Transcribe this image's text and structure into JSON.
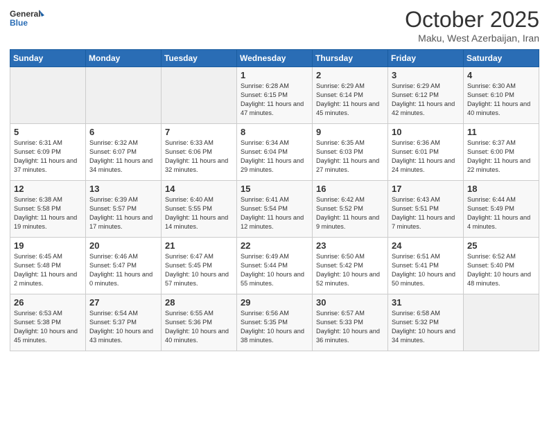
{
  "logo": {
    "line1": "General",
    "line2": "Blue"
  },
  "title": "October 2025",
  "location": "Maku, West Azerbaijan, Iran",
  "days_of_week": [
    "Sunday",
    "Monday",
    "Tuesday",
    "Wednesday",
    "Thursday",
    "Friday",
    "Saturday"
  ],
  "weeks": [
    [
      {
        "num": "",
        "info": ""
      },
      {
        "num": "",
        "info": ""
      },
      {
        "num": "",
        "info": ""
      },
      {
        "num": "1",
        "info": "Sunrise: 6:28 AM\nSunset: 6:15 PM\nDaylight: 11 hours and 47 minutes."
      },
      {
        "num": "2",
        "info": "Sunrise: 6:29 AM\nSunset: 6:14 PM\nDaylight: 11 hours and 45 minutes."
      },
      {
        "num": "3",
        "info": "Sunrise: 6:29 AM\nSunset: 6:12 PM\nDaylight: 11 hours and 42 minutes."
      },
      {
        "num": "4",
        "info": "Sunrise: 6:30 AM\nSunset: 6:10 PM\nDaylight: 11 hours and 40 minutes."
      }
    ],
    [
      {
        "num": "5",
        "info": "Sunrise: 6:31 AM\nSunset: 6:09 PM\nDaylight: 11 hours and 37 minutes."
      },
      {
        "num": "6",
        "info": "Sunrise: 6:32 AM\nSunset: 6:07 PM\nDaylight: 11 hours and 34 minutes."
      },
      {
        "num": "7",
        "info": "Sunrise: 6:33 AM\nSunset: 6:06 PM\nDaylight: 11 hours and 32 minutes."
      },
      {
        "num": "8",
        "info": "Sunrise: 6:34 AM\nSunset: 6:04 PM\nDaylight: 11 hours and 29 minutes."
      },
      {
        "num": "9",
        "info": "Sunrise: 6:35 AM\nSunset: 6:03 PM\nDaylight: 11 hours and 27 minutes."
      },
      {
        "num": "10",
        "info": "Sunrise: 6:36 AM\nSunset: 6:01 PM\nDaylight: 11 hours and 24 minutes."
      },
      {
        "num": "11",
        "info": "Sunrise: 6:37 AM\nSunset: 6:00 PM\nDaylight: 11 hours and 22 minutes."
      }
    ],
    [
      {
        "num": "12",
        "info": "Sunrise: 6:38 AM\nSunset: 5:58 PM\nDaylight: 11 hours and 19 minutes."
      },
      {
        "num": "13",
        "info": "Sunrise: 6:39 AM\nSunset: 5:57 PM\nDaylight: 11 hours and 17 minutes."
      },
      {
        "num": "14",
        "info": "Sunrise: 6:40 AM\nSunset: 5:55 PM\nDaylight: 11 hours and 14 minutes."
      },
      {
        "num": "15",
        "info": "Sunrise: 6:41 AM\nSunset: 5:54 PM\nDaylight: 11 hours and 12 minutes."
      },
      {
        "num": "16",
        "info": "Sunrise: 6:42 AM\nSunset: 5:52 PM\nDaylight: 11 hours and 9 minutes."
      },
      {
        "num": "17",
        "info": "Sunrise: 6:43 AM\nSunset: 5:51 PM\nDaylight: 11 hours and 7 minutes."
      },
      {
        "num": "18",
        "info": "Sunrise: 6:44 AM\nSunset: 5:49 PM\nDaylight: 11 hours and 4 minutes."
      }
    ],
    [
      {
        "num": "19",
        "info": "Sunrise: 6:45 AM\nSunset: 5:48 PM\nDaylight: 11 hours and 2 minutes."
      },
      {
        "num": "20",
        "info": "Sunrise: 6:46 AM\nSunset: 5:47 PM\nDaylight: 11 hours and 0 minutes."
      },
      {
        "num": "21",
        "info": "Sunrise: 6:47 AM\nSunset: 5:45 PM\nDaylight: 10 hours and 57 minutes."
      },
      {
        "num": "22",
        "info": "Sunrise: 6:49 AM\nSunset: 5:44 PM\nDaylight: 10 hours and 55 minutes."
      },
      {
        "num": "23",
        "info": "Sunrise: 6:50 AM\nSunset: 5:42 PM\nDaylight: 10 hours and 52 minutes."
      },
      {
        "num": "24",
        "info": "Sunrise: 6:51 AM\nSunset: 5:41 PM\nDaylight: 10 hours and 50 minutes."
      },
      {
        "num": "25",
        "info": "Sunrise: 6:52 AM\nSunset: 5:40 PM\nDaylight: 10 hours and 48 minutes."
      }
    ],
    [
      {
        "num": "26",
        "info": "Sunrise: 6:53 AM\nSunset: 5:38 PM\nDaylight: 10 hours and 45 minutes."
      },
      {
        "num": "27",
        "info": "Sunrise: 6:54 AM\nSunset: 5:37 PM\nDaylight: 10 hours and 43 minutes."
      },
      {
        "num": "28",
        "info": "Sunrise: 6:55 AM\nSunset: 5:36 PM\nDaylight: 10 hours and 40 minutes."
      },
      {
        "num": "29",
        "info": "Sunrise: 6:56 AM\nSunset: 5:35 PM\nDaylight: 10 hours and 38 minutes."
      },
      {
        "num": "30",
        "info": "Sunrise: 6:57 AM\nSunset: 5:33 PM\nDaylight: 10 hours and 36 minutes."
      },
      {
        "num": "31",
        "info": "Sunrise: 6:58 AM\nSunset: 5:32 PM\nDaylight: 10 hours and 34 minutes."
      },
      {
        "num": "",
        "info": ""
      }
    ]
  ]
}
